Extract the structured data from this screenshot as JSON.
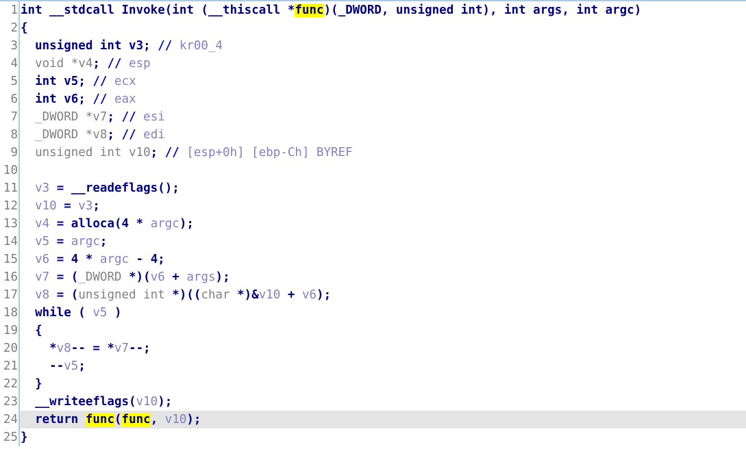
{
  "view": {
    "name": "ida-pseudocode-decompiler-view",
    "background": "#ffffff",
    "gutter_border_color": "#a8cbe8",
    "current_line_background": "#e4e4e4",
    "highlight_background": "#ffff00",
    "line_count": 25,
    "current_line": 24
  },
  "colors": {
    "keyword": "#00007f",
    "type": "#808080",
    "variable": "#8080c0",
    "comment": "#8080c0",
    "comment_marker": "#0000c8",
    "line_number": "#7d7d7d",
    "highlight": "#ffff00"
  },
  "lines": [
    {
      "n": "1",
      "current": false,
      "tokens": [
        {
          "t": "int ",
          "c": "kw"
        },
        {
          "t": "__stdcall ",
          "c": "kw"
        },
        {
          "t": "Invoke",
          "c": "fn"
        },
        {
          "t": "(",
          "c": "punc"
        },
        {
          "t": "int ",
          "c": "kw"
        },
        {
          "t": "(",
          "c": "punc"
        },
        {
          "t": "__thiscall ",
          "c": "kw"
        },
        {
          "t": "*",
          "c": "punc"
        },
        {
          "t": "func",
          "c": "hl"
        },
        {
          "t": ")(",
          "c": "punc"
        },
        {
          "t": "_DWORD",
          "c": "kw"
        },
        {
          "t": ", ",
          "c": "punc"
        },
        {
          "t": "unsigned int",
          "c": "kw"
        },
        {
          "t": "), ",
          "c": "punc"
        },
        {
          "t": "int ",
          "c": "kw"
        },
        {
          "t": "args",
          "c": "kw"
        },
        {
          "t": ", ",
          "c": "punc"
        },
        {
          "t": "int ",
          "c": "kw"
        },
        {
          "t": "argc",
          "c": "kw"
        },
        {
          "t": ")",
          "c": "punc"
        }
      ]
    },
    {
      "n": "2",
      "current": false,
      "tokens": [
        {
          "t": "{",
          "c": "punc"
        }
      ]
    },
    {
      "n": "3",
      "current": false,
      "tokens": [
        {
          "t": "  ",
          "c": "typ"
        },
        {
          "t": "unsigned int ",
          "c": "kw"
        },
        {
          "t": "v3",
          "c": "kw"
        },
        {
          "t": "; ",
          "c": "punc"
        },
        {
          "t": "//",
          "c": "cmtmark"
        },
        {
          "t": " kr00_4",
          "c": "cmt"
        }
      ]
    },
    {
      "n": "4",
      "current": false,
      "tokens": [
        {
          "t": "  ",
          "c": "typ"
        },
        {
          "t": "void ",
          "c": "typ"
        },
        {
          "t": "*",
          "c": "typ"
        },
        {
          "t": "v4",
          "c": "typ"
        },
        {
          "t": ";",
          "c": "punc"
        },
        {
          "t": " ",
          "c": "typ"
        },
        {
          "t": "//",
          "c": "cmtmark"
        },
        {
          "t": " esp",
          "c": "cmt"
        }
      ]
    },
    {
      "n": "5",
      "current": false,
      "tokens": [
        {
          "t": "  ",
          "c": "typ"
        },
        {
          "t": "int ",
          "c": "kw"
        },
        {
          "t": "v5",
          "c": "kw"
        },
        {
          "t": "; ",
          "c": "punc"
        },
        {
          "t": "//",
          "c": "cmtmark"
        },
        {
          "t": " ecx",
          "c": "cmt"
        }
      ]
    },
    {
      "n": "6",
      "current": false,
      "tokens": [
        {
          "t": "  ",
          "c": "typ"
        },
        {
          "t": "int ",
          "c": "kw"
        },
        {
          "t": "v6",
          "c": "kw"
        },
        {
          "t": "; ",
          "c": "punc"
        },
        {
          "t": "//",
          "c": "cmtmark"
        },
        {
          "t": " eax",
          "c": "cmt"
        }
      ]
    },
    {
      "n": "7",
      "current": false,
      "tokens": [
        {
          "t": "  ",
          "c": "typ"
        },
        {
          "t": "_DWORD ",
          "c": "typ"
        },
        {
          "t": "*",
          "c": "typ"
        },
        {
          "t": "v7",
          "c": "typ"
        },
        {
          "t": ";",
          "c": "punc"
        },
        {
          "t": " ",
          "c": "typ"
        },
        {
          "t": "//",
          "c": "cmtmark"
        },
        {
          "t": " esi",
          "c": "cmt"
        }
      ]
    },
    {
      "n": "8",
      "current": false,
      "tokens": [
        {
          "t": "  ",
          "c": "typ"
        },
        {
          "t": "_DWORD ",
          "c": "typ"
        },
        {
          "t": "*",
          "c": "typ"
        },
        {
          "t": "v8",
          "c": "typ"
        },
        {
          "t": ";",
          "c": "punc"
        },
        {
          "t": " ",
          "c": "typ"
        },
        {
          "t": "//",
          "c": "cmtmark"
        },
        {
          "t": " edi",
          "c": "cmt"
        }
      ]
    },
    {
      "n": "9",
      "current": false,
      "tokens": [
        {
          "t": "  ",
          "c": "typ"
        },
        {
          "t": "unsigned int ",
          "c": "typ"
        },
        {
          "t": "v10",
          "c": "typ"
        },
        {
          "t": ";",
          "c": "punc"
        },
        {
          "t": " ",
          "c": "typ"
        },
        {
          "t": "//",
          "c": "cmtmark"
        },
        {
          "t": " [esp+0h] [ebp-Ch] BYREF",
          "c": "cmt"
        }
      ]
    },
    {
      "n": "10",
      "current": false,
      "tokens": []
    },
    {
      "n": "11",
      "current": false,
      "tokens": [
        {
          "t": "  ",
          "c": "typ"
        },
        {
          "t": "v3",
          "c": "var"
        },
        {
          "t": " = ",
          "c": "punc"
        },
        {
          "t": "__readeflags",
          "c": "fn"
        },
        {
          "t": "();",
          "c": "punc"
        }
      ]
    },
    {
      "n": "12",
      "current": false,
      "tokens": [
        {
          "t": "  ",
          "c": "typ"
        },
        {
          "t": "v10",
          "c": "var"
        },
        {
          "t": " = ",
          "c": "punc"
        },
        {
          "t": "v3",
          "c": "var"
        },
        {
          "t": ";",
          "c": "punc"
        }
      ]
    },
    {
      "n": "13",
      "current": false,
      "tokens": [
        {
          "t": "  ",
          "c": "typ"
        },
        {
          "t": "v4",
          "c": "var"
        },
        {
          "t": " = ",
          "c": "punc"
        },
        {
          "t": "alloca",
          "c": "fn"
        },
        {
          "t": "(",
          "c": "punc"
        },
        {
          "t": "4",
          "c": "num"
        },
        {
          "t": " * ",
          "c": "punc"
        },
        {
          "t": "argc",
          "c": "var"
        },
        {
          "t": ");",
          "c": "punc"
        }
      ]
    },
    {
      "n": "14",
      "current": false,
      "tokens": [
        {
          "t": "  ",
          "c": "typ"
        },
        {
          "t": "v5",
          "c": "var"
        },
        {
          "t": " = ",
          "c": "punc"
        },
        {
          "t": "argc",
          "c": "var"
        },
        {
          "t": ";",
          "c": "punc"
        }
      ]
    },
    {
      "n": "15",
      "current": false,
      "tokens": [
        {
          "t": "  ",
          "c": "typ"
        },
        {
          "t": "v6",
          "c": "var"
        },
        {
          "t": " = ",
          "c": "punc"
        },
        {
          "t": "4",
          "c": "num"
        },
        {
          "t": " * ",
          "c": "punc"
        },
        {
          "t": "argc",
          "c": "var"
        },
        {
          "t": " - ",
          "c": "punc"
        },
        {
          "t": "4",
          "c": "num"
        },
        {
          "t": ";",
          "c": "punc"
        }
      ]
    },
    {
      "n": "16",
      "current": false,
      "tokens": [
        {
          "t": "  ",
          "c": "typ"
        },
        {
          "t": "v7",
          "c": "var"
        },
        {
          "t": " = (",
          "c": "punc"
        },
        {
          "t": "_DWORD ",
          "c": "typ"
        },
        {
          "t": "*)(",
          "c": "punc"
        },
        {
          "t": "v6",
          "c": "var"
        },
        {
          "t": " + ",
          "c": "punc"
        },
        {
          "t": "args",
          "c": "var"
        },
        {
          "t": ");",
          "c": "punc"
        }
      ]
    },
    {
      "n": "17",
      "current": false,
      "tokens": [
        {
          "t": "  ",
          "c": "typ"
        },
        {
          "t": "v8",
          "c": "var"
        },
        {
          "t": " = (",
          "c": "punc"
        },
        {
          "t": "unsigned int ",
          "c": "typ"
        },
        {
          "t": "*)((",
          "c": "punc"
        },
        {
          "t": "char ",
          "c": "typ"
        },
        {
          "t": "*)&",
          "c": "punc"
        },
        {
          "t": "v10",
          "c": "var"
        },
        {
          "t": " + ",
          "c": "punc"
        },
        {
          "t": "v6",
          "c": "var"
        },
        {
          "t": ");",
          "c": "punc"
        }
      ]
    },
    {
      "n": "18",
      "current": false,
      "tokens": [
        {
          "t": "  ",
          "c": "typ"
        },
        {
          "t": "while",
          "c": "kw"
        },
        {
          "t": " ( ",
          "c": "punc"
        },
        {
          "t": "v5",
          "c": "var"
        },
        {
          "t": " )",
          "c": "punc"
        }
      ]
    },
    {
      "n": "19",
      "current": false,
      "tokens": [
        {
          "t": "  ",
          "c": "typ"
        },
        {
          "t": "{",
          "c": "punc"
        }
      ]
    },
    {
      "n": "20",
      "current": false,
      "tokens": [
        {
          "t": "    ",
          "c": "typ"
        },
        {
          "t": "*",
          "c": "punc"
        },
        {
          "t": "v8",
          "c": "var"
        },
        {
          "t": "-- = *",
          "c": "punc"
        },
        {
          "t": "v7",
          "c": "var"
        },
        {
          "t": "--;",
          "c": "punc"
        }
      ]
    },
    {
      "n": "21",
      "current": false,
      "tokens": [
        {
          "t": "    ",
          "c": "typ"
        },
        {
          "t": "--",
          "c": "punc"
        },
        {
          "t": "v5",
          "c": "var"
        },
        {
          "t": ";",
          "c": "punc"
        }
      ]
    },
    {
      "n": "22",
      "current": false,
      "tokens": [
        {
          "t": "  ",
          "c": "typ"
        },
        {
          "t": "}",
          "c": "punc"
        }
      ]
    },
    {
      "n": "23",
      "current": false,
      "tokens": [
        {
          "t": "  ",
          "c": "typ"
        },
        {
          "t": "__writeeflags",
          "c": "fn"
        },
        {
          "t": "(",
          "c": "punc"
        },
        {
          "t": "v10",
          "c": "var"
        },
        {
          "t": ");",
          "c": "punc"
        }
      ]
    },
    {
      "n": "24",
      "current": true,
      "tokens": [
        {
          "t": "  ",
          "c": "typ"
        },
        {
          "t": "return",
          "c": "kw"
        },
        {
          "t": " ",
          "c": "punc"
        },
        {
          "t": "func",
          "c": "hl"
        },
        {
          "t": "(",
          "c": "punc"
        },
        {
          "t": "func",
          "c": "hl"
        },
        {
          "t": ", ",
          "c": "punc"
        },
        {
          "t": "v10",
          "c": "var"
        },
        {
          "t": ");",
          "c": "punc"
        }
      ]
    },
    {
      "n": "25",
      "current": false,
      "tokens": [
        {
          "t": "}",
          "c": "punc"
        }
      ]
    }
  ]
}
